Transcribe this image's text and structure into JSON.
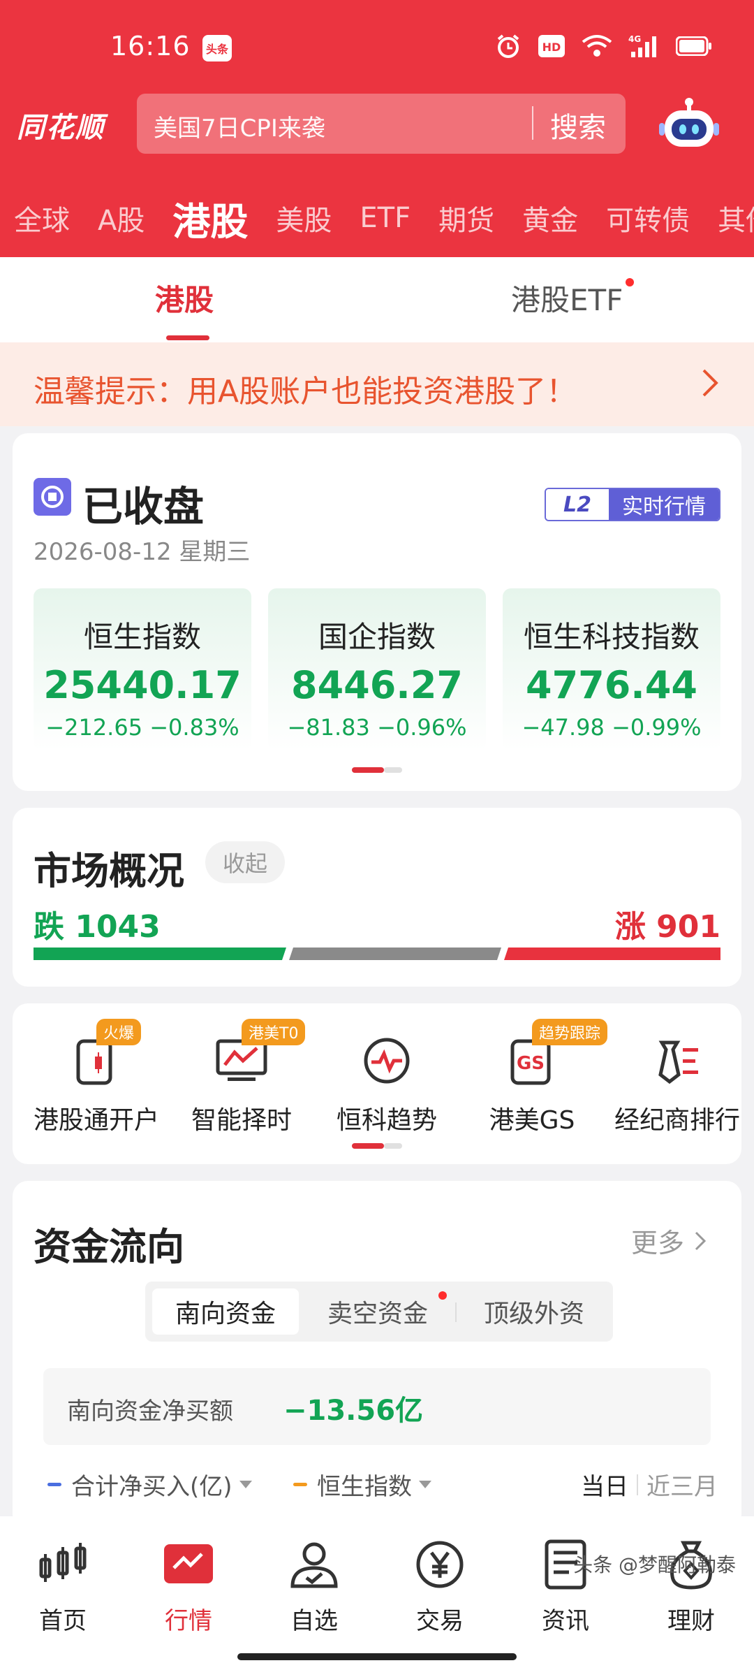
{
  "status_bar": {
    "time": "16:16",
    "badge": "头条"
  },
  "header": {
    "logo": "同花顺",
    "search_placeholder": "美国7日CPI来袭",
    "search_button": "搜索",
    "market_tabs": [
      "全球",
      "A股",
      "港股",
      "美股",
      "ETF",
      "期货",
      "黄金",
      "可转债",
      "其他"
    ],
    "active_market_tab": "港股"
  },
  "sub_tabs": {
    "active": "港股",
    "other": "港股ETF"
  },
  "tip": {
    "text": "温馨提示：用A股账户也能投资港股了！"
  },
  "index_card": {
    "status": "已收盘",
    "badge_left": "L2",
    "badge_right": "实时行情",
    "date": "2026-08-12 星期三",
    "indices": [
      {
        "name": "恒生指数",
        "value": "25440.17",
        "change": "−212.65 −0.83%"
      },
      {
        "name": "国企指数",
        "value": "8446.27",
        "change": "−81.83 −0.96%"
      },
      {
        "name": "恒生科技指数",
        "value": "4776.44",
        "change": "−47.98 −0.99%"
      }
    ]
  },
  "market_overview": {
    "title": "市场概况",
    "collapse": "收起",
    "fall_label": "跌",
    "fall_count": "1043",
    "rise_label": "涨",
    "rise_count": "901",
    "colors": {
      "fall": "#12a454",
      "flat": "#8a8a8a",
      "rise": "#e8323e"
    }
  },
  "quick_actions": [
    {
      "label": "港股通开户",
      "tag": "火爆",
      "icon": "phone-candlestick-icon"
    },
    {
      "label": "智能择时",
      "tag": "港美T0",
      "icon": "monitor-chart-icon"
    },
    {
      "label": "恒科趋势",
      "tag": "",
      "icon": "pulse-circle-icon"
    },
    {
      "label": "港美GS",
      "tag": "趋势跟踪",
      "icon": "gs-phone-icon"
    },
    {
      "label": "经纪商排行",
      "tag": "",
      "icon": "tie-list-icon"
    }
  ],
  "capital_flow": {
    "title": "资金流向",
    "more": "更多",
    "segments": [
      "南向资金",
      "卖空资金",
      "顶级外资"
    ],
    "net_label": "南向资金净买额",
    "net_value": "−13.56亿",
    "legend": [
      {
        "label": "合计净买入(亿)",
        "color": "#4a6ee0"
      },
      {
        "label": "恒生指数",
        "color": "#f39a1e"
      }
    ],
    "range_active": "当日",
    "range_other": "近三月"
  },
  "bottom_nav": [
    {
      "label": "首页",
      "icon": "candlestick-home-icon"
    },
    {
      "label": "行情",
      "icon": "market-chart-icon"
    },
    {
      "label": "自选",
      "icon": "user-check-icon"
    },
    {
      "label": "交易",
      "icon": "yen-circle-icon"
    },
    {
      "label": "资讯",
      "icon": "news-doc-icon"
    },
    {
      "label": "理财",
      "icon": "money-bag-icon"
    }
  ],
  "watermark": "头条 @梦醒阿勒泰"
}
